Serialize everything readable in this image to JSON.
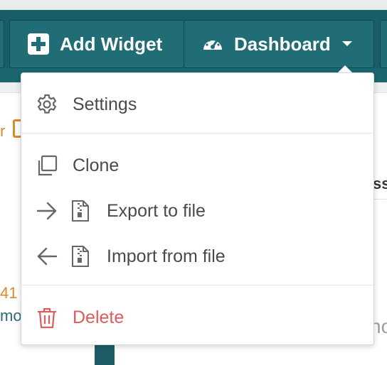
{
  "toolbar": {
    "add_widget_label": "Add Widget",
    "dashboard_label": "Dashboard",
    "colors": {
      "toolbar": "#195d66",
      "button": "#206d76"
    }
  },
  "menu": {
    "settings_label": "Settings",
    "clone_label": "Clone",
    "export_label": "Export to file",
    "import_label": "Import from file",
    "delete_label": "Delete",
    "colors": {
      "text": "#4a4a4a",
      "danger": "#e05b5b"
    }
  },
  "background": {
    "fragment_r": "r",
    "fragment_ss": "ss",
    "fragment_41": "41",
    "fragment_mo": "mo",
    "fragment_mo2": "no"
  }
}
